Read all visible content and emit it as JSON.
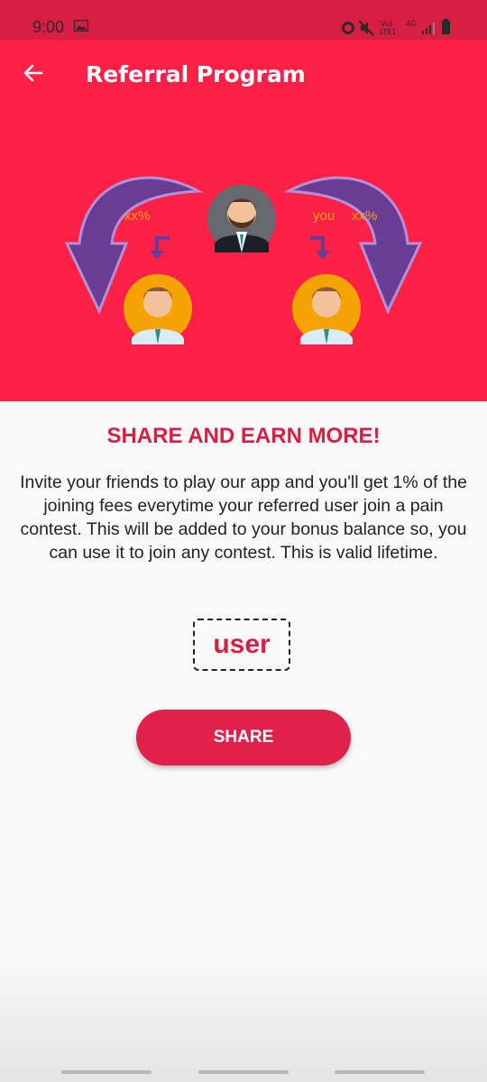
{
  "status_bar": {
    "time": "9:00",
    "network_label_1": "Vo)",
    "network_label_2": "LTE1",
    "network_label_3": "4G"
  },
  "toolbar": {
    "title": "Referral Program",
    "back_icon": "arrow-left-icon"
  },
  "banner": {
    "left_percent": "xx%",
    "right_you": "you",
    "right_percent": "xx%",
    "colors": {
      "background": "#ff2048",
      "arrow": "#6a3d94",
      "avatar_bg": "#f5a300"
    }
  },
  "content": {
    "heading": "SHARE AND EARN MORE!",
    "description": "Invite your friends to play our app and you'll get 1% of the joining fees everytime your referred user join a pain contest. This will be added to your bonus balance so, you can use it to join any contest. This is valid lifetime.",
    "referral_code": "user",
    "share_label": "SHARE"
  },
  "colors": {
    "accent": "#ff2048",
    "accent_dark": "#d91e44"
  }
}
